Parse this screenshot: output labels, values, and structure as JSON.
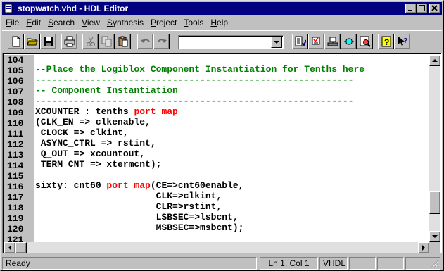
{
  "window": {
    "title": "stopwatch.vhd - HDL Editor"
  },
  "menu": [
    {
      "label": "File",
      "u": "F",
      "rest": "ile"
    },
    {
      "label": "Edit",
      "u": "E",
      "rest": "dit"
    },
    {
      "label": "Search",
      "u": "S",
      "rest": "earch"
    },
    {
      "label": "View",
      "u": "V",
      "rest": "iew"
    },
    {
      "label": "Synthesis",
      "u": "S",
      "rest": "ynthesis"
    },
    {
      "label": "Project",
      "u": "P",
      "rest": "roject"
    },
    {
      "label": "Tools",
      "u": "T",
      "rest": "ools"
    },
    {
      "label": "Help",
      "u": "H",
      "rest": "elp"
    }
  ],
  "toolbar": {
    "buttons": [
      "new-file-icon",
      "open-folder-icon",
      "save-icon",
      "print-icon",
      "cut-icon",
      "copy-icon",
      "paste-icon",
      "undo-icon",
      "redo-icon",
      "check-syntax-icon",
      "language-assistant-icon",
      "synthesis-options-icon",
      "symbol-icon",
      "find-icon",
      "help-icon",
      "context-help-icon"
    ],
    "combo_value": ""
  },
  "editor": {
    "lines": [
      {
        "num": "104",
        "segments": []
      },
      {
        "num": "105",
        "segments": [
          {
            "t": "--Place the Logiblox Component Instantiation for Tenths here",
            "c": "comment"
          }
        ]
      },
      {
        "num": "106",
        "segments": [
          {
            "t": "----------------------------------------------------------",
            "c": "comment"
          }
        ]
      },
      {
        "num": "107",
        "segments": [
          {
            "t": "-- Component Instantiation",
            "c": "comment"
          }
        ]
      },
      {
        "num": "108",
        "segments": [
          {
            "t": "----------------------------------------------------------",
            "c": "comment"
          }
        ]
      },
      {
        "num": "109",
        "segments": [
          {
            "t": "XCOUNTER : tenths ",
            "c": ""
          },
          {
            "t": "port map",
            "c": "kw"
          }
        ]
      },
      {
        "num": "110",
        "segments": [
          {
            "t": "(CLK_EN => clkenable,",
            "c": ""
          }
        ]
      },
      {
        "num": "111",
        "segments": [
          {
            "t": " CLOCK => clkint,",
            "c": ""
          }
        ]
      },
      {
        "num": "112",
        "segments": [
          {
            "t": " ASYNC_CTRL => rstint,",
            "c": ""
          }
        ]
      },
      {
        "num": "113",
        "segments": [
          {
            "t": " Q_OUT => xcountout,",
            "c": ""
          }
        ]
      },
      {
        "num": "114",
        "segments": [
          {
            "t": " TERM_CNT => xtermcnt);",
            "c": ""
          }
        ]
      },
      {
        "num": "115",
        "segments": []
      },
      {
        "num": "116",
        "segments": [
          {
            "t": "sixty: cnt60 ",
            "c": ""
          },
          {
            "t": "port map",
            "c": "kw"
          },
          {
            "t": "(CE=>cnt60enable,",
            "c": ""
          }
        ]
      },
      {
        "num": "117",
        "segments": [
          {
            "t": "                      CLK=>clkint,",
            "c": ""
          }
        ]
      },
      {
        "num": "118",
        "segments": [
          {
            "t": "                      CLR=>rstint,",
            "c": ""
          }
        ]
      },
      {
        "num": "119",
        "segments": [
          {
            "t": "                      LSBSEC=>lsbcnt,",
            "c": ""
          }
        ]
      },
      {
        "num": "120",
        "segments": [
          {
            "t": "                      MSBSEC=>msbcnt);",
            "c": ""
          }
        ]
      },
      {
        "num": "121",
        "segments": []
      }
    ],
    "vscroll_position": 0.88
  },
  "status": {
    "ready": "Ready",
    "position": "Ln 1, Col 1",
    "language": "VHDL"
  },
  "colors": {
    "titlebar": "#000080",
    "comment": "#008000",
    "keyword": "#ff0000",
    "face": "#c0c0c0"
  }
}
